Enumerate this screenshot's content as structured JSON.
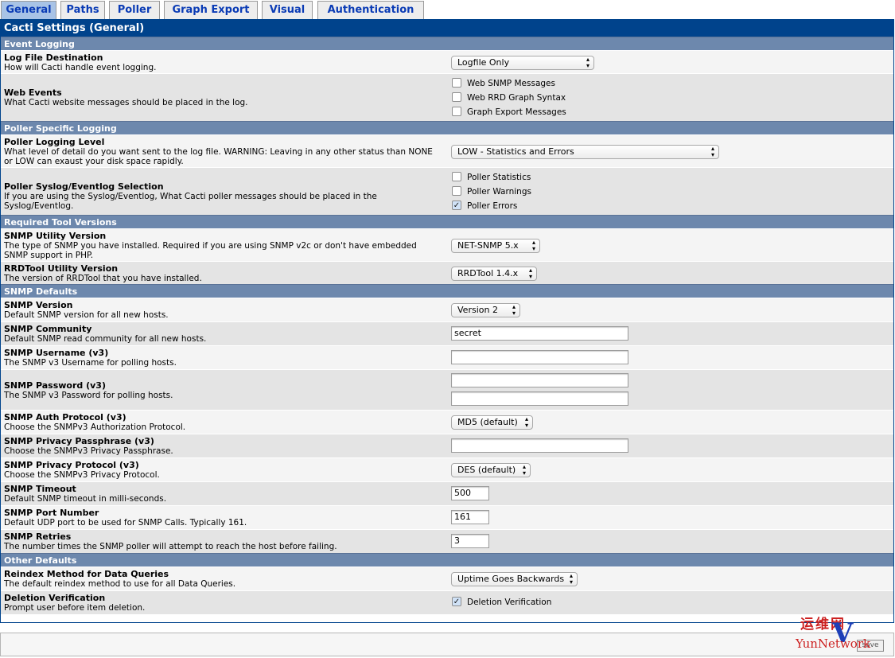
{
  "tabs": [
    "General",
    "Paths",
    "Poller",
    "Graph Export",
    "Visual",
    "Authentication"
  ],
  "panel_title": "Cacti Settings (General)",
  "sections": {
    "event_logging": "Event Logging",
    "poller_logging": "Poller Specific Logging",
    "tool_versions": "Required Tool Versions",
    "snmp_defaults": "SNMP Defaults",
    "other_defaults": "Other Defaults"
  },
  "rows": {
    "log_file_destination": {
      "title": "Log File Destination",
      "desc": "How will Cacti handle event logging.",
      "value": "Logfile Only"
    },
    "web_events": {
      "title": "Web Events",
      "desc": "What Cacti website messages should be placed in the log.",
      "options": [
        {
          "label": "Web SNMP Messages",
          "checked": false
        },
        {
          "label": "Web RRD Graph Syntax",
          "checked": false
        },
        {
          "label": "Graph Export Messages",
          "checked": false
        }
      ]
    },
    "poller_logging_level": {
      "title": "Poller Logging Level",
      "desc": "What level of detail do you want sent to the log file. WARNING: Leaving in any other status than NONE or LOW can exaust your disk space rapidly.",
      "value": "LOW - Statistics and Errors"
    },
    "poller_syslog": {
      "title": "Poller Syslog/Eventlog Selection",
      "desc": "If you are using the Syslog/Eventlog, What Cacti poller messages should be placed in the Syslog/Eventlog.",
      "options": [
        {
          "label": "Poller Statistics",
          "checked": false
        },
        {
          "label": "Poller Warnings",
          "checked": false
        },
        {
          "label": "Poller Errors",
          "checked": true
        }
      ]
    },
    "snmp_utility_version": {
      "title": "SNMP Utility Version",
      "desc": "The type of SNMP you have installed. Required if you are using SNMP v2c or don't have embedded SNMP support in PHP.",
      "value": "NET-SNMP 5.x"
    },
    "rrdtool_version": {
      "title": "RRDTool Utility Version",
      "desc": "The version of RRDTool that you have installed.",
      "value": "RRDTool 1.4.x"
    },
    "snmp_version": {
      "title": "SNMP Version",
      "desc": "Default SNMP version for all new hosts.",
      "value": "Version 2"
    },
    "snmp_community": {
      "title": "SNMP Community",
      "desc": "Default SNMP read community for all new hosts.",
      "value": "secret"
    },
    "snmp_username": {
      "title": "SNMP Username (v3)",
      "desc": "The SNMP v3 Username for polling hosts.",
      "value": ""
    },
    "snmp_password": {
      "title": "SNMP Password (v3)",
      "desc": "The SNMP v3 Password for polling hosts.",
      "value": "",
      "confirm": ""
    },
    "snmp_auth_protocol": {
      "title": "SNMP Auth Protocol (v3)",
      "desc": "Choose the SNMPv3 Authorization Protocol.",
      "value": "MD5 (default)"
    },
    "snmp_privacy_passphrase": {
      "title": "SNMP Privacy Passphrase (v3)",
      "desc": "Choose the SNMPv3 Privacy Passphrase.",
      "value": ""
    },
    "snmp_privacy_protocol": {
      "title": "SNMP Privacy Protocol (v3)",
      "desc": "Choose the SNMPv3 Privacy Protocol.",
      "value": "DES (default)"
    },
    "snmp_timeout": {
      "title": "SNMP Timeout",
      "desc": "Default SNMP timeout in milli-seconds.",
      "value": "500"
    },
    "snmp_port": {
      "title": "SNMP Port Number",
      "desc": "Default UDP port to be used for SNMP Calls. Typically 161.",
      "value": "161"
    },
    "snmp_retries": {
      "title": "SNMP Retries",
      "desc": "The number times the SNMP poller will attempt to reach the host before failing.",
      "value": "3"
    },
    "reindex_method": {
      "title": "Reindex Method for Data Queries",
      "desc": "The default reindex method to use for all Data Queries.",
      "value": "Uptime Goes Backwards"
    },
    "deletion_verification": {
      "title": "Deletion Verification",
      "desc": "Prompt user before item deletion.",
      "option": {
        "label": "Deletion Verification",
        "checked": true
      }
    }
  },
  "save_button": "save",
  "watermark": {
    "top": "运维网",
    "bottom": "YunNetwork",
    "v": "V"
  }
}
